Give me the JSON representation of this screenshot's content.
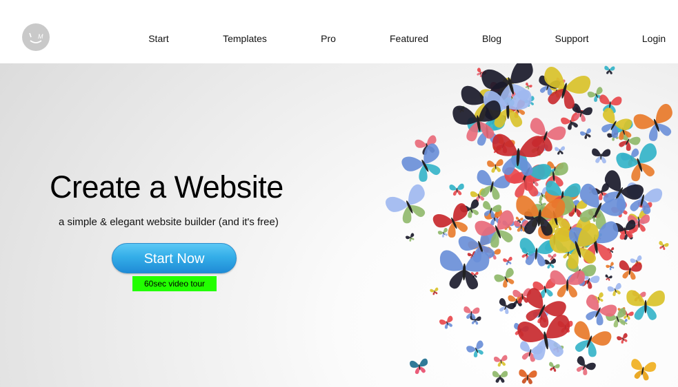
{
  "header": {
    "logo": {
      "icon": "smiley-m-logo",
      "color": "#c9c9c9"
    },
    "nav": [
      {
        "label": "Start"
      },
      {
        "label": "Templates"
      },
      {
        "label": "Pro"
      },
      {
        "label": "Featured"
      },
      {
        "label": "Blog"
      },
      {
        "label": "Support"
      },
      {
        "label": "Login"
      }
    ]
  },
  "hero": {
    "title": "Create a Website",
    "subtitle": "a simple & elegant website builder (and it's free)",
    "cta_label": "Start Now",
    "video_tour_label": "60sec video tour",
    "image": "butterfly-swarm-illustration",
    "colors": {
      "cta": "#34aee8",
      "video_tour_bg": "#22ff00"
    }
  }
}
